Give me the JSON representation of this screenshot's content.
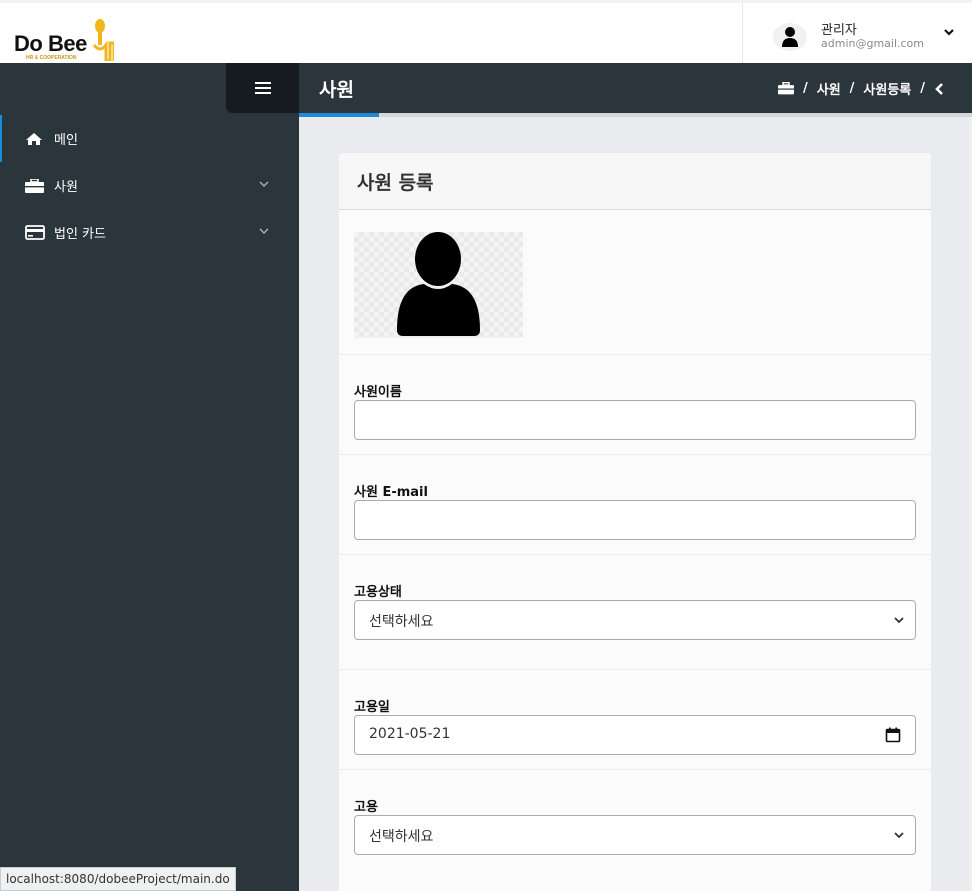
{
  "logo": {
    "text_do": "Do",
    "text_bee": "Bee",
    "subtitle": "HR & COOPERATION",
    "brand_color": "#f2b51c"
  },
  "user": {
    "name": "관리자",
    "email": "admin@gmail.com",
    "avatar_icon": "user-icon",
    "dropdown_icon": "chevron-down-icon"
  },
  "sidebar": {
    "toggle_icon": "hamburger-icon",
    "background": "#2b353c",
    "items": [
      {
        "label": "메인",
        "icon": "home-icon",
        "active": true,
        "expandable": false
      },
      {
        "label": "사원",
        "icon": "briefcase-icon",
        "active": false,
        "expandable": true
      },
      {
        "label": "법인 카드",
        "icon": "credit-card-icon",
        "active": false,
        "expandable": true
      }
    ]
  },
  "content_header": {
    "title": "사원",
    "breadcrumb": {
      "home_icon": "briefcase-icon",
      "sep": "/",
      "items": [
        "사원",
        "사원등록"
      ],
      "back_icon": "chevron-left-icon"
    },
    "accent_color": "#1e8bd6"
  },
  "form": {
    "title": "사원 등록",
    "photo_icon": "user-silhouette-icon",
    "fields": {
      "name": {
        "label": "사원이름",
        "value": ""
      },
      "email": {
        "label": "사원 E-mail",
        "value": ""
      },
      "status": {
        "label": "고용상태",
        "selected": "선택하세요"
      },
      "hire_date": {
        "label": "고용일",
        "value": "2021-05-21"
      },
      "employment": {
        "label": "고용",
        "selected": "선택하세요"
      }
    }
  },
  "statusbar": {
    "url": "localhost:8080/dobeeProject/main.do"
  }
}
